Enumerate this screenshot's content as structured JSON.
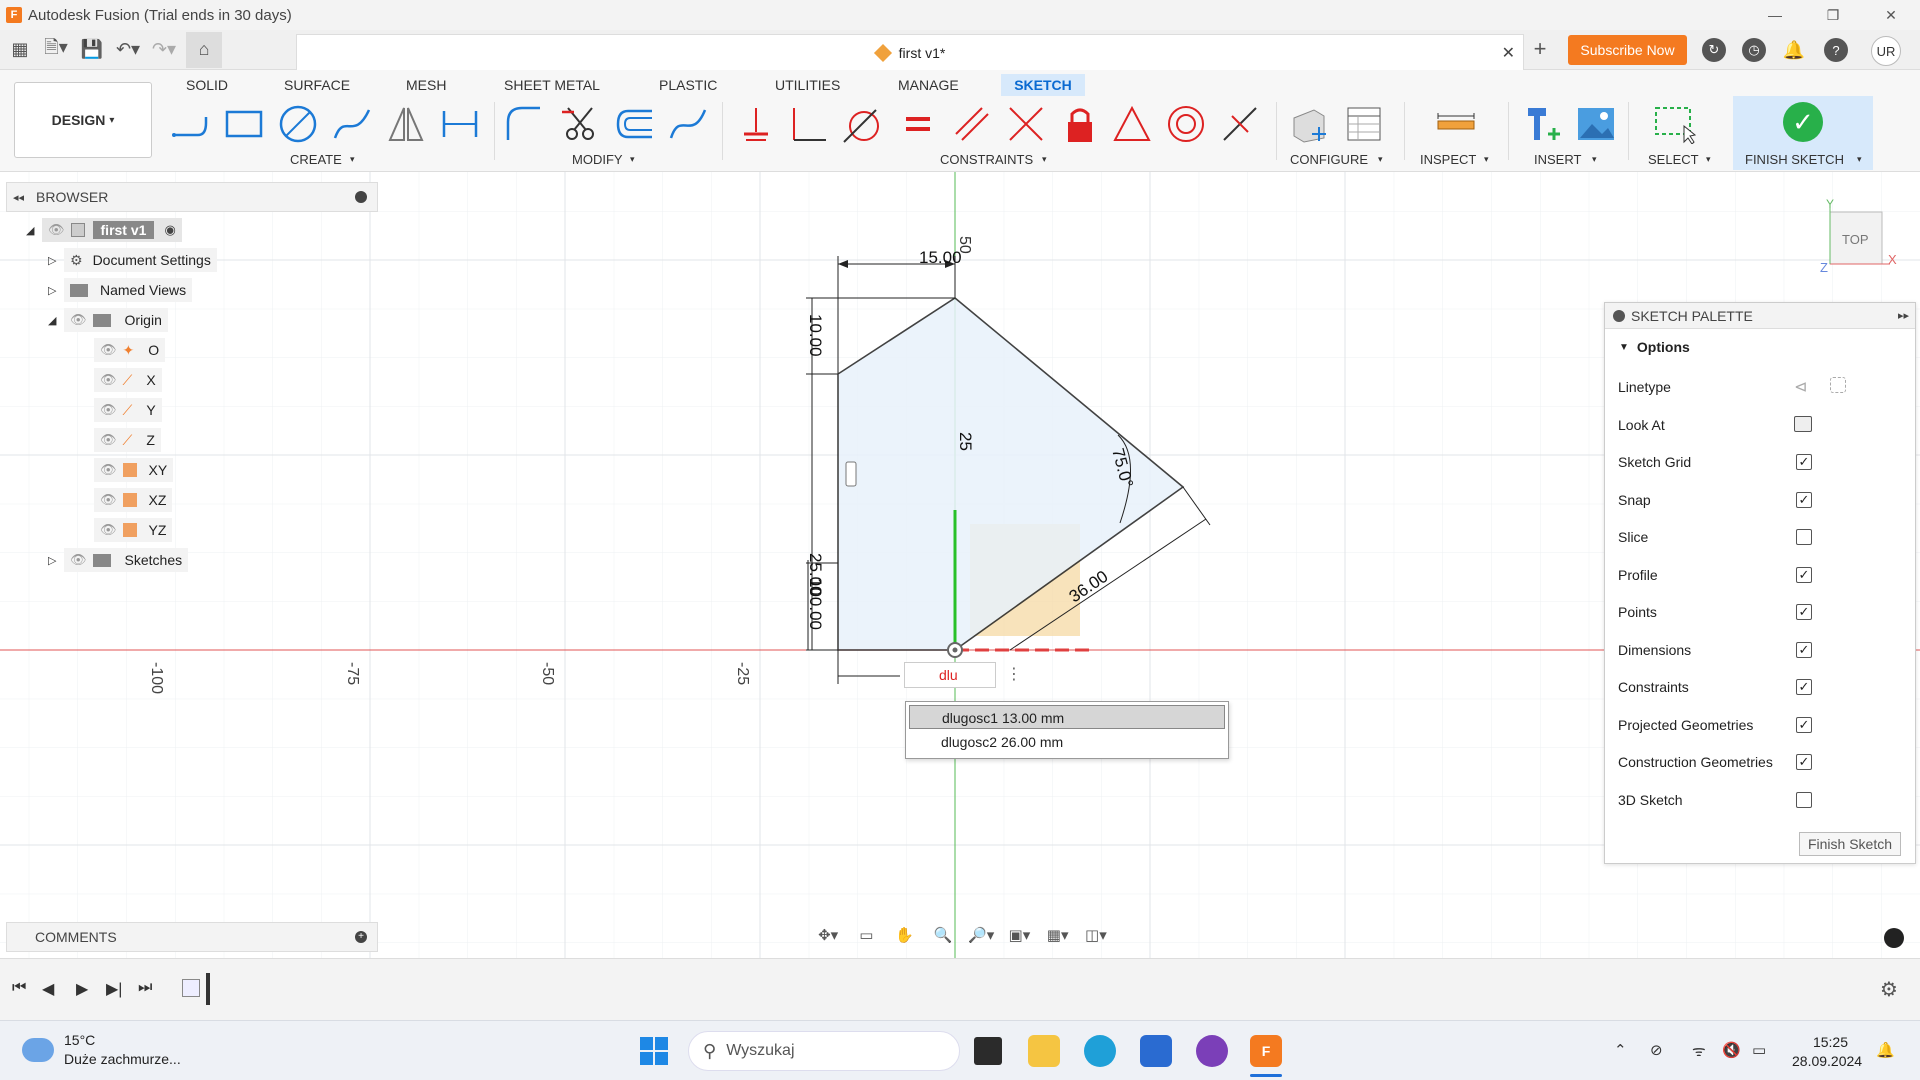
{
  "titlebar": {
    "title": "Autodesk Fusion (Trial ends in 30 days)"
  },
  "qbar": {
    "document_tab": "first v1*",
    "subscribe": "Subscribe Now",
    "user_initials": "UR"
  },
  "ribbon": {
    "workspace": "DESIGN",
    "tabs": [
      "SOLID",
      "SURFACE",
      "MESH",
      "SHEET METAL",
      "PLASTIC",
      "UTILITIES",
      "MANAGE",
      "SKETCH"
    ],
    "active_tab": "SKETCH",
    "groups": [
      "CREATE",
      "MODIFY",
      "CONSTRAINTS",
      "CONFIGURE",
      "INSPECT",
      "INSERT",
      "SELECT",
      "FINISH SKETCH"
    ]
  },
  "browser": {
    "title": "BROWSER",
    "root": "first v1",
    "items": [
      "Document Settings",
      "Named Views",
      "Origin",
      "O",
      "X",
      "Y",
      "Z",
      "XY",
      "XZ",
      "YZ",
      "Sketches"
    ]
  },
  "comments": {
    "title": "COMMENTS"
  },
  "sketch": {
    "dimensions": [
      "15.00",
      "10.00",
      "25",
      "75.0°",
      "36.00",
      "25.00",
      "100.00",
      "50"
    ],
    "axis_ticks": [
      "-100",
      "-75",
      "-50",
      "-25"
    ],
    "input_value": "dlu",
    "autocomplete": [
      {
        "name": "dlugosc1",
        "value": "13.00 mm"
      },
      {
        "name": "dlugosc2",
        "value": "26.00 mm"
      }
    ]
  },
  "viewcube": {
    "face": "TOP",
    "axis_x": "X",
    "axis_y": "Y",
    "axis_z": "Z"
  },
  "palette": {
    "title": "SKETCH PALETTE",
    "section": "Options",
    "rows": [
      {
        "label": "Linetype",
        "kind": "icons"
      },
      {
        "label": "Look At",
        "kind": "icon"
      },
      {
        "label": "Sketch Grid",
        "checked": true
      },
      {
        "label": "Snap",
        "checked": true
      },
      {
        "label": "Slice",
        "checked": false
      },
      {
        "label": "Profile",
        "checked": true
      },
      {
        "label": "Points",
        "checked": true
      },
      {
        "label": "Dimensions",
        "checked": true
      },
      {
        "label": "Constraints",
        "checked": true
      },
      {
        "label": "Projected Geometries",
        "checked": true
      },
      {
        "label": "Construction Geometries",
        "checked": true
      },
      {
        "label": "3D Sketch",
        "checked": false
      }
    ],
    "finish_button": "Finish Sketch"
  },
  "taskbar": {
    "temperature": "15°C",
    "weather": "Duże zachmurze...",
    "search_placeholder": "Wyszukaj",
    "time": "15:25",
    "date": "28.09.2024"
  }
}
